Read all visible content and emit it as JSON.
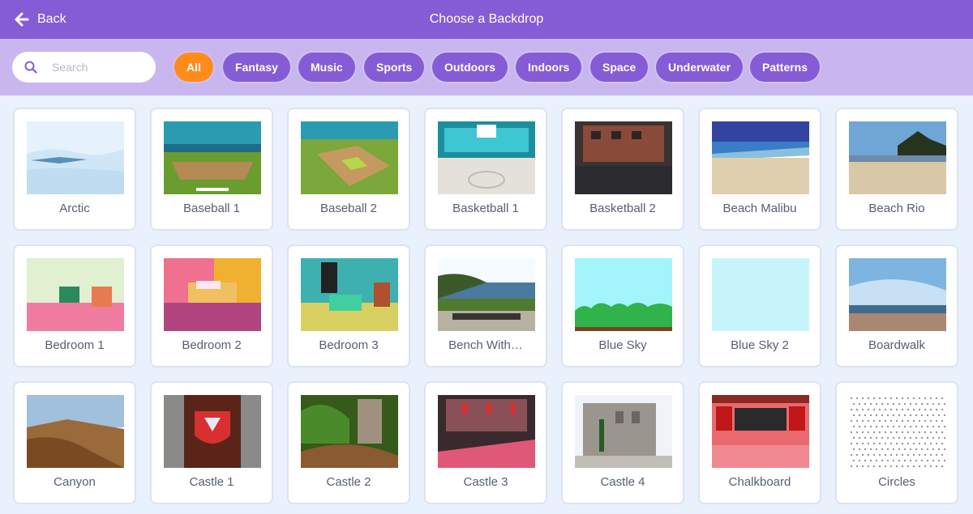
{
  "header": {
    "back_label": "Back",
    "title": "Choose a Backdrop"
  },
  "search": {
    "placeholder": "Search",
    "value": ""
  },
  "categories": [
    "All",
    "Fantasy",
    "Music",
    "Sports",
    "Outdoors",
    "Indoors",
    "Space",
    "Underwater",
    "Patterns"
  ],
  "selected_category": "All",
  "colors": {
    "header": "#855cd6",
    "filter_bar": "#c9b6ef",
    "chip": "#855cd6",
    "chip_active": "#ff8c1a",
    "background": "#e9f1fc",
    "label_text": "#575e75"
  },
  "backdrops": [
    {
      "name": "Arctic"
    },
    {
      "name": "Baseball 1"
    },
    {
      "name": "Baseball 2"
    },
    {
      "name": "Basketball 1"
    },
    {
      "name": "Basketball 2"
    },
    {
      "name": "Beach Malibu"
    },
    {
      "name": "Beach Rio"
    },
    {
      "name": "Bedroom 1"
    },
    {
      "name": "Bedroom 2"
    },
    {
      "name": "Bedroom 3"
    },
    {
      "name": "Bench With…"
    },
    {
      "name": "Blue Sky"
    },
    {
      "name": "Blue Sky 2"
    },
    {
      "name": "Boardwalk"
    },
    {
      "name": "Canyon"
    },
    {
      "name": "Castle 1"
    },
    {
      "name": "Castle 2"
    },
    {
      "name": "Castle 3"
    },
    {
      "name": "Castle 4"
    },
    {
      "name": "Chalkboard"
    },
    {
      "name": "Circles"
    }
  ]
}
